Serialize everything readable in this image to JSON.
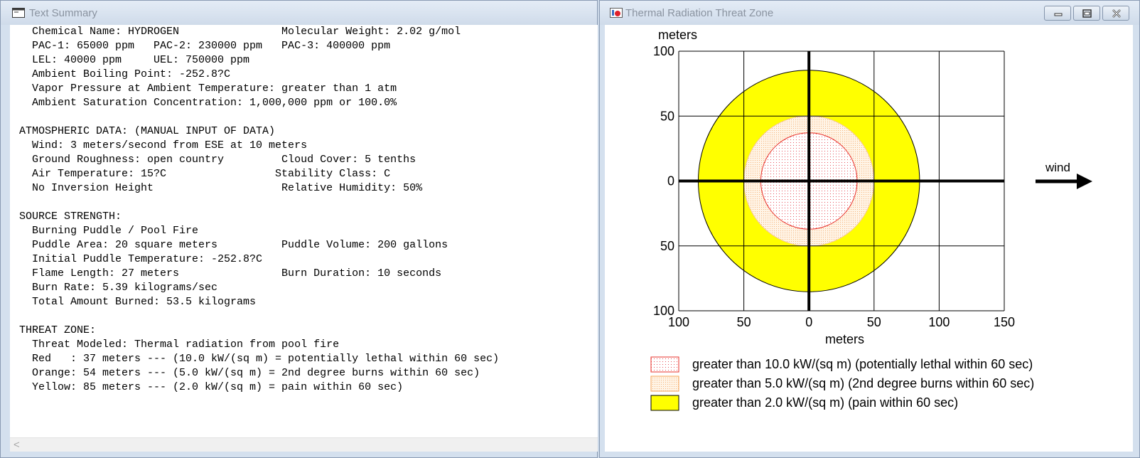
{
  "text_window": {
    "title": "Text Summary",
    "lines": [
      "  Chemical Name: HYDROGEN                Molecular Weight: 2.02 g/mol",
      "  PAC-1: 65000 ppm   PAC-2: 230000 ppm   PAC-3: 400000 ppm",
      "  LEL: 40000 ppm     UEL: 750000 ppm",
      "  Ambient Boiling Point: -252.8?C",
      "  Vapor Pressure at Ambient Temperature: greater than 1 atm",
      "  Ambient Saturation Concentration: 1,000,000 ppm or 100.0%",
      "",
      "ATMOSPHERIC DATA: (MANUAL INPUT OF DATA)",
      "  Wind: 3 meters/second from ESE at 10 meters",
      "  Ground Roughness: open country         Cloud Cover: 5 tenths",
      "  Air Temperature: 15?C                 Stability Class: C",
      "  No Inversion Height                    Relative Humidity: 50%",
      "",
      "SOURCE STRENGTH:",
      "  Burning Puddle / Pool Fire",
      "  Puddle Area: 20 square meters          Puddle Volume: 200 gallons",
      "  Initial Puddle Temperature: -252.8?C",
      "  Flame Length: 27 meters                Burn Duration: 10 seconds",
      "  Burn Rate: 5.39 kilograms/sec",
      "  Total Amount Burned: 53.5 kilograms",
      "",
      "THREAT ZONE:",
      "  Threat Modeled: Thermal radiation from pool fire",
      "  Red   : 37 meters --- (10.0 kW/(sq m) = potentially lethal within 60 sec)",
      "  Orange: 54 meters --- (5.0 kW/(sq m) = 2nd degree burns within 60 sec)",
      "  Yellow: 85 meters --- (2.0 kW/(sq m) = pain within 60 sec)"
    ],
    "scroll_left_glyph": "<"
  },
  "plot_window": {
    "title": "Thermal Radiation Threat Zone",
    "controls": {
      "minimize": "minimize",
      "restore": "restore",
      "close": "close"
    },
    "wind_label": "wind",
    "legend": [
      {
        "label": "greater than 10.0 kW/(sq m) (potentially lethal within 60 sec)",
        "color": "#ffffff",
        "stroke": "#e8302a",
        "pattern": "red-dots"
      },
      {
        "label": "greater than 5.0 kW/(sq m) (2nd degree burns within 60 sec)",
        "color": "#fde3c6",
        "stroke": "#f5a45a",
        "pattern": "orange-dots"
      },
      {
        "label": "greater than 2.0 kW/(sq m) (pain within 60 sec)",
        "color": "#ffff00",
        "stroke": "#000000",
        "pattern": "solid"
      }
    ]
  },
  "chart_data": {
    "type": "scatter",
    "xlabel": "meters",
    "ylabel": "meters",
    "xlim": [
      -100,
      150
    ],
    "ylim": [
      -100,
      100
    ],
    "x_ticks": [
      -100,
      -50,
      0,
      50,
      100,
      150
    ],
    "x_tick_labels": [
      "100",
      "50",
      "0",
      "50",
      "100",
      "150"
    ],
    "y_ticks": [
      100,
      50,
      0,
      -50,
      -100
    ],
    "y_tick_labels": [
      "100",
      "50",
      "0",
      "50",
      "100"
    ],
    "grid": true,
    "zones": [
      {
        "name": "Yellow",
        "radius": 85,
        "center_x": 0,
        "color": "#ffff00"
      },
      {
        "name": "Orange",
        "radius": 50,
        "center_x": 0,
        "color": "#fde3c6"
      },
      {
        "name": "Red",
        "radius": 37,
        "center_x": 0,
        "color": "#ffffff"
      }
    ]
  }
}
